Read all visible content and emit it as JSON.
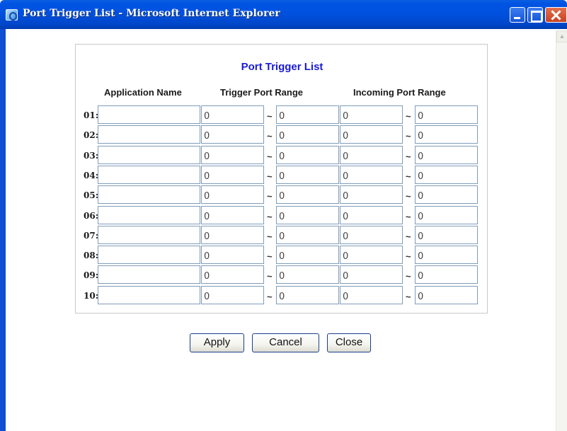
{
  "window": {
    "title": "Port Trigger List - Microsoft Internet Explorer",
    "icon": "ie-icon"
  },
  "panel": {
    "title": "Port Trigger List",
    "columns": {
      "application": "Application Name",
      "trigger": "Trigger Port Range",
      "incoming": "Incoming Port Range"
    },
    "separator": "~"
  },
  "rows": [
    {
      "num": "01:",
      "app": "",
      "trigger_start": "0",
      "trigger_end": "0",
      "incoming_start": "0",
      "incoming_end": "0"
    },
    {
      "num": "02:",
      "app": "",
      "trigger_start": "0",
      "trigger_end": "0",
      "incoming_start": "0",
      "incoming_end": "0"
    },
    {
      "num": "03:",
      "app": "",
      "trigger_start": "0",
      "trigger_end": "0",
      "incoming_start": "0",
      "incoming_end": "0"
    },
    {
      "num": "04:",
      "app": "",
      "trigger_start": "0",
      "trigger_end": "0",
      "incoming_start": "0",
      "incoming_end": "0"
    },
    {
      "num": "05:",
      "app": "",
      "trigger_start": "0",
      "trigger_end": "0",
      "incoming_start": "0",
      "incoming_end": "0"
    },
    {
      "num": "06:",
      "app": "",
      "trigger_start": "0",
      "trigger_end": "0",
      "incoming_start": "0",
      "incoming_end": "0"
    },
    {
      "num": "07:",
      "app": "",
      "trigger_start": "0",
      "trigger_end": "0",
      "incoming_start": "0",
      "incoming_end": "0"
    },
    {
      "num": "08:",
      "app": "",
      "trigger_start": "0",
      "trigger_end": "0",
      "incoming_start": "0",
      "incoming_end": "0"
    },
    {
      "num": "09:",
      "app": "",
      "trigger_start": "0",
      "trigger_end": "0",
      "incoming_start": "0",
      "incoming_end": "0"
    },
    {
      "num": "10:",
      "app": "",
      "trigger_start": "0",
      "trigger_end": "0",
      "incoming_start": "0",
      "incoming_end": "0"
    }
  ],
  "buttons": {
    "apply": "Apply",
    "cancel": "Cancel",
    "close": "Close"
  },
  "colors": {
    "title_text": "#1a1ad6",
    "field_border": "#7f9db9",
    "titlebar": "#0054e3"
  }
}
